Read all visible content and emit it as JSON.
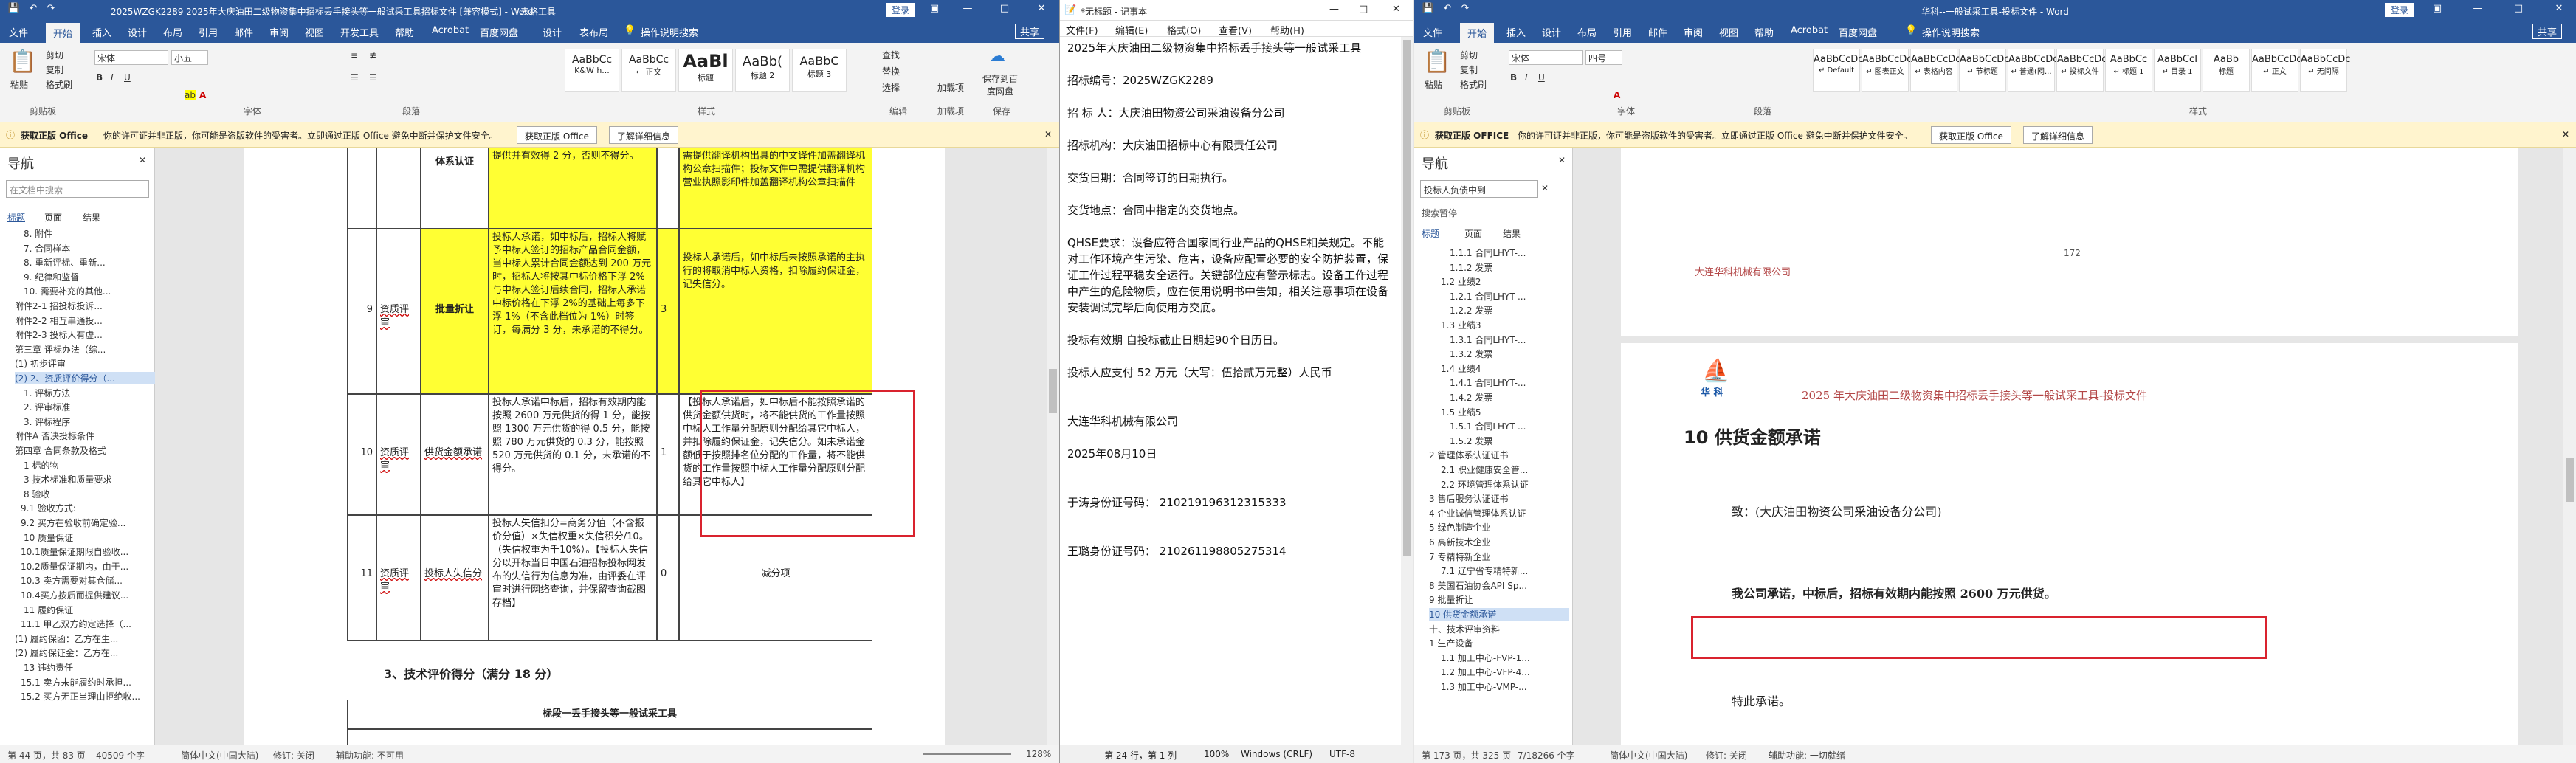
{
  "win1": {
    "title": "2025WZGK2289 2025年大庆油田二级物资集中招标丢手接头等一般试采工具招标文件 [兼容模式] - Word",
    "table_tools": "表格工具",
    "login": "登录",
    "tabs": [
      "文件",
      "开始",
      "插入",
      "设计",
      "布局",
      "引用",
      "邮件",
      "审阅",
      "视图",
      "开发工具",
      "帮助",
      "Acrobat",
      "百度网盘",
      "设计",
      "表布局"
    ],
    "tell_me": "操作说明搜索",
    "share": "共享",
    "clipboard": {
      "paste": "粘贴",
      "cut": "剪切",
      "copy": "复制",
      "painter": "格式刷",
      "group": "剪贴板"
    },
    "font": {
      "name": "宋体",
      "size": "小五",
      "group": "字体"
    },
    "para_group": "段落",
    "styles": [
      {
        "sample": "AaBbCc",
        "name": "K&W h..."
      },
      {
        "sample": "AaBbCc",
        "name": "↵ 正文"
      },
      {
        "sample": "AaBl",
        "name": "标题"
      },
      {
        "sample": "AaBb(",
        "name": "标题 2"
      },
      {
        "sample": "AaBbC",
        "name": "标题 3"
      }
    ],
    "styles_group": "样式",
    "edit": {
      "find": "查找",
      "replace": "替换",
      "select": "选择",
      "group": "编辑"
    },
    "addins": {
      "label": "加载项",
      "group": "加载项"
    },
    "baidu": {
      "label": "保存到百度网盘",
      "group": "保存"
    },
    "infobar": {
      "badge": "获取正版 Office",
      "text": "你的许可证并非正版，你可能是盗版软件的受害者。立即通过正版 Office 避免中断并保护文件安全。",
      "btn1": "获取正版 Office",
      "btn2": "了解详细信息"
    },
    "nav": {
      "title": "导航",
      "search_placeholder": "在文档中搜索",
      "tabs": [
        "标题",
        "页面",
        "结果"
      ],
      "items": [
        "8. 附件",
        "7. 合同样本",
        "8. 重新评标、重新...",
        "9. 纪律和监督",
        "10. 需要补充的其他...",
        "附件2-1 招投标投诉...",
        "附件2-2 相互串通投...",
        "附件2-3 投标人有虚...",
        "第三章 评标办法（综...",
        "(1) 初步评审",
        "(2) 2、资质评价得分（...",
        "1. 评标方法",
        "2. 评审标准",
        "3. 评标程序",
        "附件A 否决投标条件",
        "第四章 合同条款及格式",
        "1 标的物",
        "3 技术标准和质量要求",
        "8 验收",
        "9.1 验收方式:",
        "9.2 买方在验收前确定验...",
        "10 质量保证",
        "10.1质量保证期限自验收...",
        "10.2质量保证期内，由于...",
        "10.3 卖方需要对其仓储...",
        "10.4买方按质而提供建议...",
        "11 履约保证",
        "11.1 甲乙双方约定选择（...",
        "(1) 履约保函：乙方在生...",
        "(2) 履约保证金：乙方在...",
        "13 违约责任",
        "15.1 卖方未能履约时承担...",
        "15.2 买方无正当理由拒绝收..."
      ]
    },
    "table": {
      "row9": {
        "no": "9",
        "cat": "资质评审",
        "item": "批量折让",
        "text": "投标人承诺，如中标后，招标人将赋予中标人签订的招标产品合同金额，当中标人累计合同金额达到 200 万元时，招标人将按其中标价格下浮 2%与中标人签订后续合同，招标人承诺中标价格在下浮 2%的基础上每多下浮 1%（不含此档位为 1%）时签订，每满分 3 分，未承诺的不得分。",
        "score": "3",
        "remark": "投标人承诺后，如中标后未按照承诺的主执行的将取消中标人资格，扣除履约保证金，记失信分。"
      },
      "row10": {
        "no": "10",
        "cat": "资质评审",
        "item": "供货金额承诺",
        "text": "投标人承诺中标后，招标有效期内能按照 2600 万元供货的得 1 分，能按照 1300 万元供货的得 0.5 分，能按照 780 万元供货的 0.3 分，能按照 520 万元供货的 0.1 分，未承诺的不得分。",
        "score": "1",
        "remark": "【投标人承诺后，如中标后不能按照承诺的供货金额供货时，将不能供货的工作量按照中标人工作量分配原则分配给其它中标人，并扣除履约保证金，记失信分。如未承诺金额低于按照排名位分配的工作量，将不能供货的工作量按照中标人工作量分配原则分配给其它中标人】"
      },
      "row11": {
        "no": "11",
        "cat": "资质评审",
        "item": "投标人失信分",
        "text": "投标人失信扣分=商务分值（不含报价分值）×失信权重×失信积分/10。（失信权重为千10%）。【投标人失信分以开标当日中国石油招标投标网发布的失信行为信息为准，由评委在评审时进行网络查询，并保留查询截图存档】",
        "score": "0",
        "remark": "减分项"
      },
      "row_top": {
        "cat": "体系认证",
        "text": "提供并有效得 2 分，否则不得分。",
        "remark": "需提供翻译机构出具的中文译件加盖翻译机构公章扫描件；投标文件中需提供翻译机构营业执照影印件加盖翻译机构公章扫描件"
      }
    },
    "heading": "3、技术评价得分（满分 18 分）",
    "subtable_title": "标段一丢手接头等一般试采工具",
    "status": {
      "page": "第 44 页，共 83 页",
      "words": "40509 个字",
      "lang": "简体中文(中国大陆)",
      "track": "修订: 关闭",
      "access": "辅助功能: 不可用",
      "zoom": "128%"
    }
  },
  "notepad": {
    "title": "*无标题 - 记事本",
    "menu": [
      "文件(F)",
      "编辑(E)",
      "格式(O)",
      "查看(V)",
      "帮助(H)"
    ],
    "lines": [
      "2025年大庆油田二级物资集中招标丢手接头等一般试采工具",
      "",
      "招标编号：2025WZGK2289",
      "",
      "招 标 人：大庆油田物资公司采油设备分公司",
      "",
      "招标机构：大庆油田招标中心有限责任公司",
      "",
      "交货日期：合同签订的日期执行。",
      "",
      "交货地点：合同中指定的交货地点。",
      "",
      "QHSE要求：设备应符合国家同行业产品的QHSE相关规定。不能对工作环境产生污染、危害，设备应配置必要的安全防护装置，保证工作过程平稳安全运行。关键部位应有警示标志。设备工作过程中产生的危险物质，应在使用说明书中告知，相关注意事项在设备安装调试完毕后向使用方交底。",
      "",
      "投标有效期            自投标截止日期起90个日历日。",
      "",
      "投标人应支付 52 万元（大写：伍拾贰万元整）人民币",
      "",
      "",
      "大连华科机械有限公司",
      "",
      "2025年08月10日",
      "",
      "",
      "于涛身份证号码：   210219196312315333",
      "",
      "",
      "王璐身份证号码：   210261198805275314"
    ],
    "status": {
      "pos": "第 24 行，第 1 列",
      "zoom": "100%",
      "eol": "Windows (CRLF)",
      "enc": "UTF-8"
    }
  },
  "win2": {
    "title": "华科--一般试采工具-投标文件 - Word",
    "login": "登录",
    "tabs": [
      "文件",
      "开始",
      "插入",
      "设计",
      "布局",
      "引用",
      "邮件",
      "审阅",
      "视图",
      "帮助",
      "Acrobat",
      "百度网盘"
    ],
    "tell_me": "操作说明搜索",
    "share": "共享",
    "clipboard": {
      "paste": "粘贴",
      "cut": "剪切",
      "copy": "复制",
      "painter": "格式刷",
      "group": "剪贴板"
    },
    "font": {
      "name": "宋体",
      "size": "四号",
      "group": "字体"
    },
    "para_group": "段落",
    "styles": [
      {
        "sample": "AaBbCcDc",
        "name": "↵ Default"
      },
      {
        "sample": "AaBbCcDc",
        "name": "↵ 图表正文"
      },
      {
        "sample": "AaBbCcDc",
        "name": "↵ 表格内容"
      },
      {
        "sample": "AaBbCcDc",
        "name": "↵ 节标题"
      },
      {
        "sample": "AaBbCcDc",
        "name": "↵ 普通(网..."
      },
      {
        "sample": "AaBbCcDc",
        "name": "↵ 投标文件"
      },
      {
        "sample": "AaBbCc",
        "name": "↵ 标题 1"
      },
      {
        "sample": "AaBbCcI",
        "name": "↵ 目录 1"
      },
      {
        "sample": "AaBb",
        "name": "标题"
      },
      {
        "sample": "AaBbCcDc",
        "name": "↵ 正文"
      },
      {
        "sample": "AaBbCcDc",
        "name": "↵ 无间隔"
      }
    ],
    "styles_group": "样式",
    "infobar": {
      "badge": "获取正版 OFFICE",
      "text": "你的许可证并非正版，你可能是盗版软件的受害者。立即通过正版 Office 避免中断并保护文件安全。",
      "btn1": "获取正版 Office",
      "btn2": "了解详细信息"
    },
    "nav": {
      "title": "导航",
      "search_value": "投标人负债中到",
      "search_hint": "搜索暂停",
      "tabs": [
        "标题",
        "页面",
        "结果"
      ],
      "items": [
        "1.1.1 合同LHYT-...",
        "1.1.2 发票",
        "1.2 业绩2",
        "1.2.1 合同LHYT-...",
        "1.2.2 发票",
        "1.3 业绩3",
        "1.3.1 合同LHYT-...",
        "1.3.2 发票",
        "1.4 业绩4",
        "1.4.1 合同LHYT-...",
        "1.4.2 发票",
        "1.5 业绩5",
        "1.5.1 合同LHYT-...",
        "1.5.2 发票",
        "2 管理体系认证证书",
        "2.1 职业健康安全管...",
        "2.2 环境管理体系认证",
        "3 售后服务认证证书",
        "4 企业诚信管理体系认证",
        "5 绿色制造企业",
        "6 高新技术企业",
        "7 专精特新企业",
        "7.1 辽宁省专精特新...",
        "8 美国石油协会API Sp...",
        "9 批量折让",
        "10 供货金额承诺",
        "十、技术评审资料",
        "1 生产设备",
        "1.1 加工中心-FVP-1...",
        "1.2 加工中心-VFP-4...",
        "1.3 加工中心-VMP-..."
      ]
    },
    "doc": {
      "page_no": "172",
      "header_prev": "大连华科机械有限公司",
      "header": "2025 年大庆油田二级物资集中招标丢手接头等一般试采工具-投标文件",
      "logo": "华 科",
      "heading": "10 供货金额承诺",
      "to": "致：(大庆油田物资公司采油设备分公司)",
      "commit": "我公司承诺，中标后，招标有效期内能按照 2600 万元供货。",
      "special": "特此承诺。"
    },
    "status": {
      "page": "第 173 页，共 325 页",
      "words": "7/18266 个字",
      "lang": "简体中文(中国大陆)",
      "track": "修订: 关闭",
      "access": "辅助功能: 一切就绪"
    }
  },
  "colors": {
    "word_blue": "#2b579a",
    "highlight": "#ffff33",
    "annotation_red": "#d9232e",
    "info_yellow": "#fff4ce"
  }
}
